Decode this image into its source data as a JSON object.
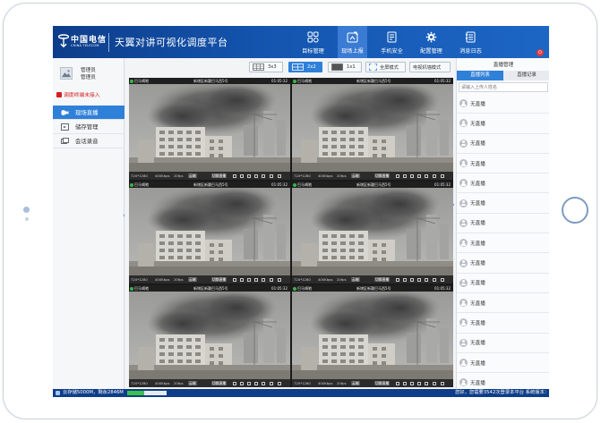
{
  "brand": {
    "logo_cn": "中国电信",
    "logo_en": "CHINA TELECOM",
    "title": "天翼对讲可视化调度平台"
  },
  "nav": [
    {
      "label": "目标管理",
      "icon": "target-grid-icon",
      "active": false
    },
    {
      "label": "现场上报",
      "icon": "report-upload-icon",
      "active": true
    },
    {
      "label": "手机安全",
      "icon": "phone-security-icon",
      "active": false
    },
    {
      "label": "配置管理",
      "icon": "gear-icon",
      "active": false
    },
    {
      "label": "消息日志",
      "icon": "log-book-icon",
      "active": false
    }
  ],
  "user": {
    "name": "管理员",
    "role": "管理员",
    "warning": "调度终端未接入"
  },
  "menu": [
    {
      "label": "现场直播",
      "icon": "live-camera-icon",
      "active": true
    },
    {
      "label": "储存管理",
      "icon": "storage-folder-icon",
      "active": false
    },
    {
      "label": "会话录音",
      "icon": "recording-icon",
      "active": false
    }
  ],
  "toolbar": {
    "layout_3x3": "3x3",
    "layout_2x2": "2x2",
    "layout_1x1": "1x1",
    "fullscreen": "全屏模式",
    "tv_wall": "电视机墙模式",
    "active_layout": "2x2"
  },
  "cells": [
    {
      "name": "巴马嘀嗒",
      "location": "新增区新疆巴马西5号",
      "time": "01:05:32",
      "resolution": "720*1280",
      "bitrate": "400Kbps",
      "fps": "20fps",
      "tag1": "云端",
      "tag2": "切换直播"
    },
    {
      "name": "巴马嘀嗒",
      "location": "新增区新疆巴马西5号",
      "time": "01:05:32",
      "resolution": "720*1280",
      "bitrate": "400Kbps",
      "fps": "20fps",
      "tag1": "云端",
      "tag2": "切换直播"
    },
    {
      "name": "巴马嘀嗒",
      "location": "新增区新疆巴马西5号",
      "time": "01:05:32",
      "resolution": "720*1280",
      "bitrate": "400Kbps",
      "fps": "20fps",
      "tag1": "云端",
      "tag2": "切换直播"
    },
    {
      "name": "巴马嘀嗒",
      "location": "新增区新疆巴马西5号",
      "time": "01:05:32",
      "resolution": "720*1280",
      "bitrate": "400Kbps",
      "fps": "20fps",
      "tag1": "云端",
      "tag2": "切换直播"
    },
    {
      "name": "巴马嘀嗒",
      "location": "新增区新疆巴马西5号",
      "time": "01:05:32",
      "resolution": "720*1280",
      "bitrate": "400Kbps",
      "fps": "20fps",
      "tag1": "云端",
      "tag2": "切换直播"
    },
    {
      "name": "巴马嘀嗒",
      "location": "新增区新疆巴马西5号",
      "time": "01:05:32",
      "resolution": "720*1280",
      "bitrate": "400Kbps",
      "fps": "20fps",
      "tag1": "云端",
      "tag2": "切换直播"
    }
  ],
  "right_panel": {
    "title": "直播管理",
    "tabs": [
      {
        "label": "直播列表",
        "active": true
      },
      {
        "label": "直播记录",
        "active": false
      }
    ],
    "search_placeholder": "请输入上传人姓名",
    "items": [
      "无直播",
      "无直播",
      "无直播",
      "无直播",
      "无直播",
      "无直播",
      "无直播",
      "无直播",
      "无直播",
      "无直播",
      "无直播",
      "无直播",
      "无直播",
      "无直播",
      "无直播"
    ]
  },
  "status_bar": {
    "storage": "云存储5000M，剩余2846M",
    "storage_used_fraction": 0.43,
    "welcome": "您好，您需要3542次登录本平台 系统版本：",
    "colors": {
      "accent": "#2f80d8",
      "header": "#1456b0",
      "warning": "#d21f1f"
    }
  }
}
